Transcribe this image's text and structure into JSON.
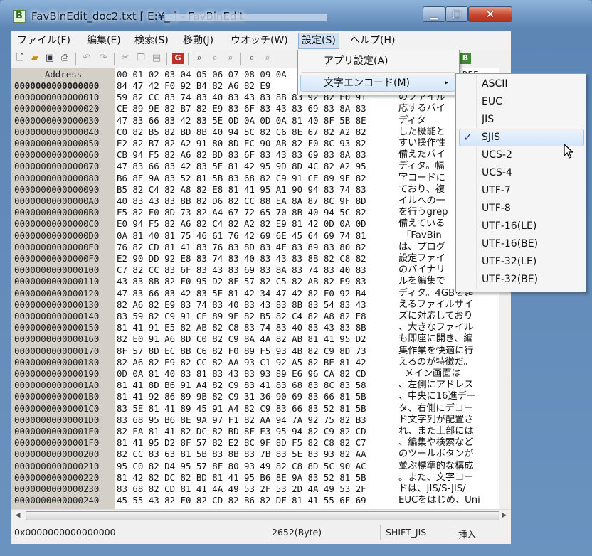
{
  "window": {
    "title": "FavBinEdit_doc2.txt [ E:¥_                                                    ] - FavBinEdit",
    "app_icon_letter": "B"
  },
  "menubar": [
    "ファイル(F)",
    "編集(E)",
    "検索(S)",
    "移動(J)",
    "ウオッチ(W)",
    "設定(S)",
    "ヘルプ(H)"
  ],
  "toolbar_icons": [
    "new-file-icon",
    "open-folder-icon",
    "save-icon",
    "print-icon",
    "undo-icon",
    "redo-icon",
    "cut-icon",
    "copy-icon",
    "paste-icon",
    "goto-icon",
    "find-icon",
    "find-next-icon",
    "find-prev-icon",
    "zoom-icon",
    "zoom2-icon"
  ],
  "settings_menu": {
    "items": [
      "アプリ設定(A)",
      "文字エンコード(M)"
    ],
    "submenu_arrow": "▸"
  },
  "encoding_menu": {
    "items": [
      "ASCII",
      "EUC",
      "JIS",
      "SJIS",
      "UCS-2",
      "UCS-4",
      "UTF-7",
      "UTF-8",
      "UTF-16(LE)",
      "UTF-16(BE)",
      "UTF-32(LE)",
      "UTF-32(BE)"
    ],
    "selected": "SJIS",
    "check": "✓"
  },
  "editor": {
    "address_header": "Address",
    "hex_header": "00 01 02 03 04 05 06 07 08 09 0A",
    "text_header": "DEF",
    "rows": [
      {
        "addr": "0000000000000000",
        "hex": "84 47 42 F0 92 B4 82 A6 82 E9",
        "text": ""
      },
      {
        "addr": "0000000000000010",
        "hex": "59 82 CC 83 74 83 40 83 43 83 8B 83 92 82 E0 91",
        "text": "のファイル"
      },
      {
        "addr": "0000000000000020",
        "hex": "CE 89 9E 82 B7 82 E9 83 6F 83 43 83 69 83 8A 83",
        "text": "応するバイ"
      },
      {
        "addr": "0000000000000030",
        "hex": "47 83 66 83 42 83 5E 0D 0A 0D 0A 81 40 8F 5B 8E",
        "text": "ディタ"
      },
      {
        "addr": "0000000000000040",
        "hex": "C0 82 B5 82 BD 8B 40 94 5C 82 C6 8E 67 82 A2 82",
        "text": "した機能と"
      },
      {
        "addr": "0000000000000050",
        "hex": "E2 82 B7 82 A2 91 80 8D EC 90 AB 82 F0 8C 93 82",
        "text": "すい操作性"
      },
      {
        "addr": "0000000000000060",
        "hex": "CB 94 F5 82 A6 82 BD 83 6F 83 43 83 69 83 8A 83",
        "text": "備えたバイ"
      },
      {
        "addr": "0000000000000070",
        "hex": "47 83 66 83 42 83 5E 81 42 95 9D 8D 4C 82 A2 95",
        "text": "ディタ。幅"
      },
      {
        "addr": "0000000000000080",
        "hex": "B6 8E 9A 83 52 81 5B 83 68 82 C9 91 CE 89 9E 82",
        "text": "字コードに"
      },
      {
        "addr": "0000000000000090",
        "hex": "B5 82 C4 82 A8 82 E8 81 41 95 A1 90 94 83 74 83",
        "text": "ており、複"
      },
      {
        "addr": "00000000000000A0",
        "hex": "40 83 43 83 8B 82 D6 82 CC 88 EA 8A 87 8C 9F 8D",
        "text": "イルへの一"
      },
      {
        "addr": "00000000000000B0",
        "hex": "F5 82 F0 8D 73 82 A4 67 72 65 70 8B 40 94 5C 82",
        "text": "を行うgrep"
      },
      {
        "addr": "00000000000000C0",
        "hex": "E0 94 F5 82 A6 82 C4 82 A2 82 E9 81 42 0D 0A 0D",
        "text": "備えている"
      },
      {
        "addr": "00000000000000D0",
        "hex": "0A 81 40 81 75 46 61 76 42 69 6E 45 64 69 74 81",
        "text": " 「FavBin"
      },
      {
        "addr": "00000000000000E0",
        "hex": "76 82 CD 81 41 83 76 83 8D 83 4F 83 89 83 80 82",
        "text": "は、プログ"
      },
      {
        "addr": "00000000000000F0",
        "hex": "E2 90 DD 92 E8 83 74 83 40 83 43 83 8B 82 C8 82",
        "text": "設定ファイ"
      },
      {
        "addr": "0000000000000100",
        "hex": "C7 82 CC 83 6F 83 43 83 69 83 8A 83 74 83 40 83",
        "text": "のバイナリ"
      },
      {
        "addr": "0000000000000110",
        "hex": "43 83 8B 82 F0 95 D2 8F 57 82 C5 82 AB 82 E9 83",
        "text": "ルを編集で"
      },
      {
        "addr": "0000000000000120",
        "hex": "47 83 66 83 42 83 5E 81 42 34 47 42 82 F0 92 B4",
        "text": "ディタ。4GBを超"
      },
      {
        "addr": "0000000000000130",
        "hex": "82 A6 82 E9 83 74 83 40 83 43 83 8B 83 54 83 43",
        "text": "えるファイルサイ"
      },
      {
        "addr": "0000000000000140",
        "hex": "83 59 82 C9 91 CE 89 9E 82 B5 82 C4 82 A8 82 E8",
        "text": "ズに対応しており"
      },
      {
        "addr": "0000000000000150",
        "hex": "81 41 91 E5 82 AB 82 C8 83 74 83 40 83 43 83 8B",
        "text": "、大きなファイル"
      },
      {
        "addr": "0000000000000160",
        "hex": "82 E0 91 A6 8D C0 82 C9 8A 4A 82 AB 81 41 95 D2",
        "text": "も即座に開き、編"
      },
      {
        "addr": "0000000000000170",
        "hex": "8F 57 8D EC 8B C6 82 F0 89 F5 93 4B 82 C9 8D 73",
        "text": "集作業を快適に行"
      },
      {
        "addr": "0000000000000180",
        "hex": "82 A6 82 E9 82 CC 82 AA 93 C1 92 A5 82 BE 81 42",
        "text": "えるのが特徴だ。"
      },
      {
        "addr": "0000000000000190",
        "hex": "0D 0A 81 40 83 81 83 43 83 93 89 E6 96 CA 82 CD",
        "text": "  メイン画面は"
      },
      {
        "addr": "00000000000001A0",
        "hex": "81 41 8D B6 91 A4 82 C9 83 41 83 68 83 8C 83 58",
        "text": "、左側にアドレス"
      },
      {
        "addr": "00000000000001B0",
        "hex": "81 41 92 86 89 9B 82 C9 31 36 90 69 83 66 81 5B",
        "text": "、中央に16進デー"
      },
      {
        "addr": "00000000000001C0",
        "hex": "83 5E 81 41 89 45 91 A4 82 C9 83 66 83 52 81 5B",
        "text": "タ、右側にデコー"
      },
      {
        "addr": "00000000000001D0",
        "hex": "83 68 95 B6 8E 9A 97 F1 82 AA 94 7A 92 75 82 B3",
        "text": "ド文字列が配置さ"
      },
      {
        "addr": "00000000000001E0",
        "hex": "82 EA 81 41 82 DC 82 BD 8F E3 95 94 82 C9 82 CD",
        "text": "れ、また上部には"
      },
      {
        "addr": "00000000000001F0",
        "hex": "81 41 95 D2 8F 57 82 E2 8C 9F 8D F5 82 C8 82 C7",
        "text": "、編集や検索など"
      },
      {
        "addr": "0000000000000200",
        "hex": "82 CC 83 63 81 5B 83 8B 83 7B 83 5E 83 93 82 AA",
        "text": "のツールボタンが"
      },
      {
        "addr": "0000000000000210",
        "hex": "95 C0 82 D4 95 57 8F 80 93 49 82 C8 8D 5C 90 AC",
        "text": "並ぶ標準的な構成"
      },
      {
        "addr": "0000000000000220",
        "hex": "81 42 82 DC 82 BD 81 41 95 B6 8E 9A 83 52 81 5B",
        "text": "。また、文字コー"
      },
      {
        "addr": "0000000000000230",
        "hex": "83 68 82 CD 81 41 4A 49 53 2F 53 2D 4A 49 53 2F",
        "text": "ドは、JIS/S-JIS/"
      },
      {
        "addr": "0000000000000240",
        "hex": "45 55 43 82 F0 82 CD 82 B6 82 DF 81 41 55 6E 69",
        "text": "EUCをはじめ、Uni"
      }
    ]
  },
  "statusbar": {
    "position": "0x0000000000000000",
    "size": "2652(Byte)",
    "encoding": "SHIFT_JIS",
    "mode": "挿入"
  }
}
